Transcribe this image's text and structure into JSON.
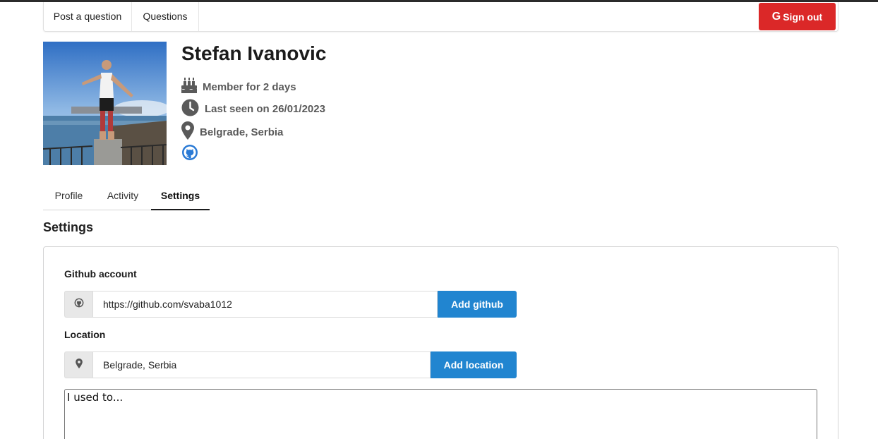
{
  "nav": {
    "post_question": "Post a question",
    "questions": "Questions",
    "sign_out": "Sign out",
    "sign_out_icon": "google-icon"
  },
  "profile": {
    "name": "Stefan Ivanovic",
    "member_for": "Member for 2 days",
    "last_seen": "Last seen on 26/01/2023",
    "location": "Belgrade, Serbia",
    "icons": {
      "member": "cake-icon",
      "seen": "clock-icon",
      "location": "map-pin-icon",
      "github": "github-icon"
    }
  },
  "tabs": [
    {
      "label": "Profile",
      "active": false
    },
    {
      "label": "Activity",
      "active": false
    },
    {
      "label": "Settings",
      "active": true
    }
  ],
  "settings": {
    "title": "Settings",
    "github": {
      "label": "Github account",
      "value": "https://github.com/svaba1012",
      "button": "Add github"
    },
    "location": {
      "label": "Location",
      "value": "Belgrade, Serbia",
      "button": "Add location"
    },
    "bio": {
      "value": "I used to..."
    }
  },
  "colors": {
    "sign_out_bg": "#db2828",
    "primary_button": "#2185d0",
    "icon_gray": "#5a5a5a",
    "github_icon_blue": "#2a7ad5"
  }
}
